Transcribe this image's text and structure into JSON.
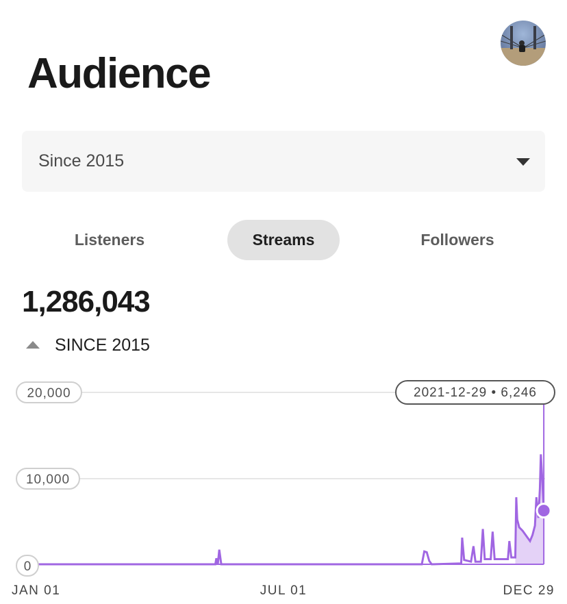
{
  "header": {
    "title": "Audience",
    "avatar_icon": "profile-photo"
  },
  "range_select": {
    "value": "Since 2015",
    "icon": "chevron-down-icon"
  },
  "tabs": [
    {
      "label": "Listeners",
      "active": false
    },
    {
      "label": "Streams",
      "active": true
    },
    {
      "label": "Followers",
      "active": false
    }
  ],
  "summary": {
    "total": "1,286,043",
    "trend_icon": "triangle-up-icon",
    "since_label": "SINCE 2015"
  },
  "colors": {
    "accent": "#a066e2",
    "accent_fill": "#e4d2f7",
    "active_tab_bg": "#e2e2e2"
  },
  "tooltip": {
    "text": "2021-12-29 • 6,246"
  },
  "chart_data": {
    "type": "area",
    "title": "",
    "xlabel": "",
    "ylabel": "",
    "ylim": [
      0,
      20000
    ],
    "y_ticks": [
      "0",
      "10,000",
      "20,000"
    ],
    "x_ticks": [
      "JAN 01",
      "JUL 01",
      "DEC 29"
    ],
    "grid": true,
    "highlight": {
      "date": "2021-12-29",
      "value": 6246
    },
    "series": [
      {
        "points": [
          [
            0.0,
            0
          ],
          [
            0.36,
            0
          ],
          [
            0.362,
            700
          ],
          [
            0.365,
            0
          ],
          [
            0.368,
            1700
          ],
          [
            0.372,
            0
          ],
          [
            0.4,
            0
          ],
          [
            0.78,
            0
          ],
          [
            0.785,
            1500
          ],
          [
            0.79,
            1400
          ],
          [
            0.795,
            400
          ],
          [
            0.8,
            0
          ],
          [
            0.86,
            100
          ],
          [
            0.862,
            3100
          ],
          [
            0.866,
            500
          ],
          [
            0.88,
            300
          ],
          [
            0.885,
            2100
          ],
          [
            0.889,
            300
          ],
          [
            0.9,
            300
          ],
          [
            0.904,
            4100
          ],
          [
            0.908,
            600
          ],
          [
            0.92,
            600
          ],
          [
            0.924,
            3800
          ],
          [
            0.928,
            600
          ],
          [
            0.955,
            600
          ],
          [
            0.958,
            2700
          ],
          [
            0.962,
            800
          ],
          [
            0.97,
            800
          ],
          [
            0.972,
            7800
          ],
          [
            0.974,
            5200
          ],
          [
            0.978,
            4300
          ],
          [
            0.985,
            3900
          ],
          [
            0.99,
            3500
          ],
          [
            0.995,
            3100
          ],
          [
            1.0,
            2700
          ],
          [
            1.005,
            3400
          ],
          [
            1.01,
            4500
          ],
          [
            1.013,
            7800
          ],
          [
            1.017,
            5400
          ],
          [
            1.02,
            8800
          ],
          [
            1.022,
            12800
          ],
          [
            1.025,
            9800
          ],
          [
            1.028,
            6246
          ]
        ]
      }
    ]
  }
}
